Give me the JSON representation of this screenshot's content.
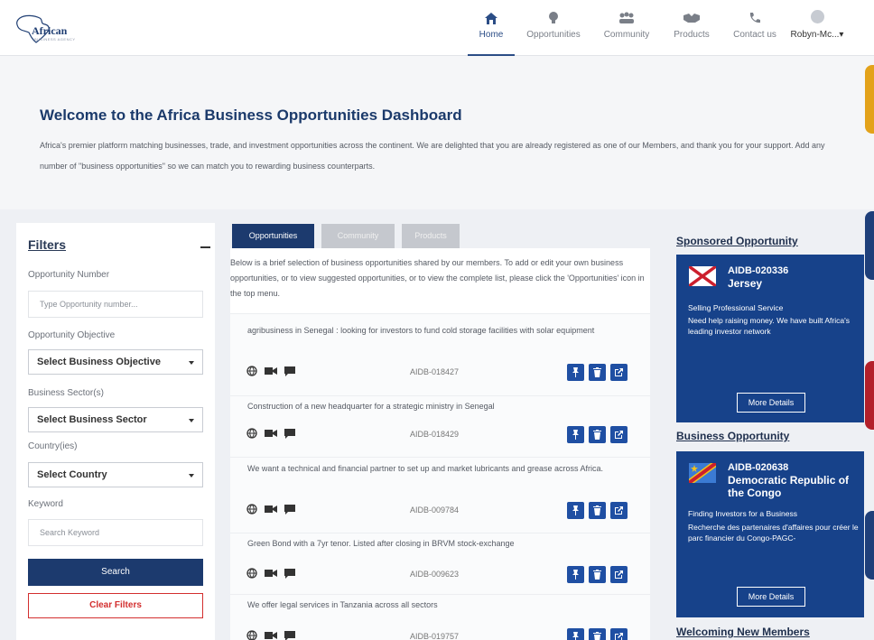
{
  "header": {
    "logo_text": "African",
    "logo_sub": "BUSINESS AGENCY",
    "nav": [
      {
        "label": "Home",
        "icon": "home-icon",
        "active": true
      },
      {
        "label": "Opportunities",
        "icon": "lightbulb-icon",
        "active": false
      },
      {
        "label": "Community",
        "icon": "people-icon",
        "active": false
      },
      {
        "label": "Products",
        "icon": "handshake-icon",
        "active": false
      },
      {
        "label": "Contact us",
        "icon": "phone-icon",
        "active": false
      }
    ],
    "user_label": "Robyn-Mc...▾"
  },
  "welcome": {
    "title": "Welcome to the Africa Business Opportunities Dashboard",
    "text": "Africa's premier platform matching businesses, trade, and investment opportunities across the continent. We are delighted that you are already registered as one of our Members, and thank you for your support. Add any number of \"business opportunities\" so we can match you to rewarding business counterparts."
  },
  "filters": {
    "title": "Filters",
    "opportunity_number_label": "Opportunity Number",
    "opportunity_number_placeholder": "Type Opportunity number...",
    "objective_label": "Opportunity Objective",
    "objective_value": "Select Business Objective",
    "sector_label": "Business Sector(s)",
    "sector_value": "Select Business Sector",
    "country_label": "Country(ies)",
    "country_value": "Select Country",
    "keyword_label": "Keyword",
    "keyword_placeholder": "Search Keyword",
    "search_label": "Search",
    "clear_label": "Clear Filters"
  },
  "tabs": [
    {
      "label": "Opportunities",
      "active": true
    },
    {
      "label": "Community",
      "active": false
    },
    {
      "label": "Products",
      "active": false
    }
  ],
  "intro": "Below is a brief selection of business opportunities shared by our members. To add or edit your own business opportunities, or to view suggested opportunities, or to view the complete list, please click the 'Opportunities' icon in the top menu.",
  "opportunities": [
    {
      "title": "agribusiness in Senegal : looking for investors to fund cold storage facilities with solar equipment",
      "id": "AIDB-018427"
    },
    {
      "title": "Construction of a new headquarter for a strategic ministry in Senegal",
      "id": "AIDB-018429"
    },
    {
      "title": "We want a technical and financial partner to set up and market lubricants and grease across Africa.",
      "id": "AIDB-009784"
    },
    {
      "title": "Green Bond with a 7yr tenor. Listed after closing in BRVM stock-exchange",
      "id": "AIDB-009623"
    },
    {
      "title": "We offer legal services in Tanzania across all sectors",
      "id": "AIDB-019757"
    }
  ],
  "sponsored": {
    "section_title": "Sponsored Opportunity",
    "id": "AIDB-020336",
    "country": "Jersey",
    "line1": "Selling Professional Service",
    "line2": "Need help raising money. We have built Africa's leading investor network",
    "button": "More Details"
  },
  "business": {
    "section_title": "Business Opportunity",
    "id": "AIDB-020638",
    "country": "Democratic Republic of the Congo",
    "line1": "Finding Investors for a Business",
    "line2": "Recherche des partenaires d'affaires pour créer le parc financier du Congo-PAGC-",
    "button": "More Details"
  },
  "welcoming_title": "Welcoming New Members",
  "colors": {
    "navy": "#1c3a6e",
    "card_blue": "#17428a",
    "action_blue": "#1f4fa3",
    "clear_red": "#d32f2f",
    "edge_gold": "#e3a21a",
    "edge_blue": "#1e3f7a",
    "edge_red": "#b3202a"
  }
}
